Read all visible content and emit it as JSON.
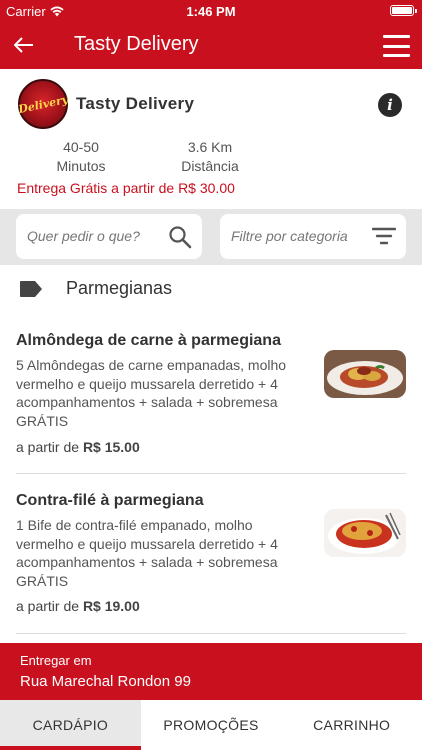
{
  "status_bar": {
    "carrier": "Carrier",
    "time": "1:46 PM"
  },
  "nav": {
    "title": "Tasty Delivery",
    "back_icon": "arrow-left-icon",
    "menu_icon": "hamburger-menu-icon"
  },
  "restaurant": {
    "logo_text": "Delivery",
    "name": "Tasty Delivery",
    "minutes_value": "40-50",
    "minutes_label": "Minutos",
    "distance_value": "3.6 Km",
    "distance_label": "Distância",
    "free_delivery": "Entrega Grátis a partir de R$ 30.00"
  },
  "search": {
    "placeholder": "Quer pedir o que?",
    "filter_placeholder": "Filtre por categoria"
  },
  "category": {
    "label": "Parmegianas"
  },
  "items": [
    {
      "name": "Almôndega de carne à parmegiana",
      "description": "5 Almôndegas de carne empanadas, molho vermelho e queijo mussarela derretido + 4 acompanhamentos + salada + sobremesa GRÁTIS",
      "price_prefix": "a partir de",
      "price": "R$ 15.00"
    },
    {
      "name": "Contra-filé à parmegiana",
      "description": "1 Bife de contra-filé empanado, molho vermelho e queijo mussarela derretido + 4 acompanhamentos + salada + sobremesa GRÁTIS",
      "price_prefix": "a partir de",
      "price": "R$ 19.00"
    }
  ],
  "delivery": {
    "label": "Entregar em",
    "address": "Rua Marechal Rondon 99"
  },
  "tabs": [
    {
      "label": "CARDÁPIO",
      "active": true
    },
    {
      "label": "PROMOÇÕES",
      "active": false
    },
    {
      "label": "CARRINHO",
      "active": false
    }
  ],
  "colors": {
    "brand": "#c9101e",
    "search_bg": "#e6e6e6"
  }
}
